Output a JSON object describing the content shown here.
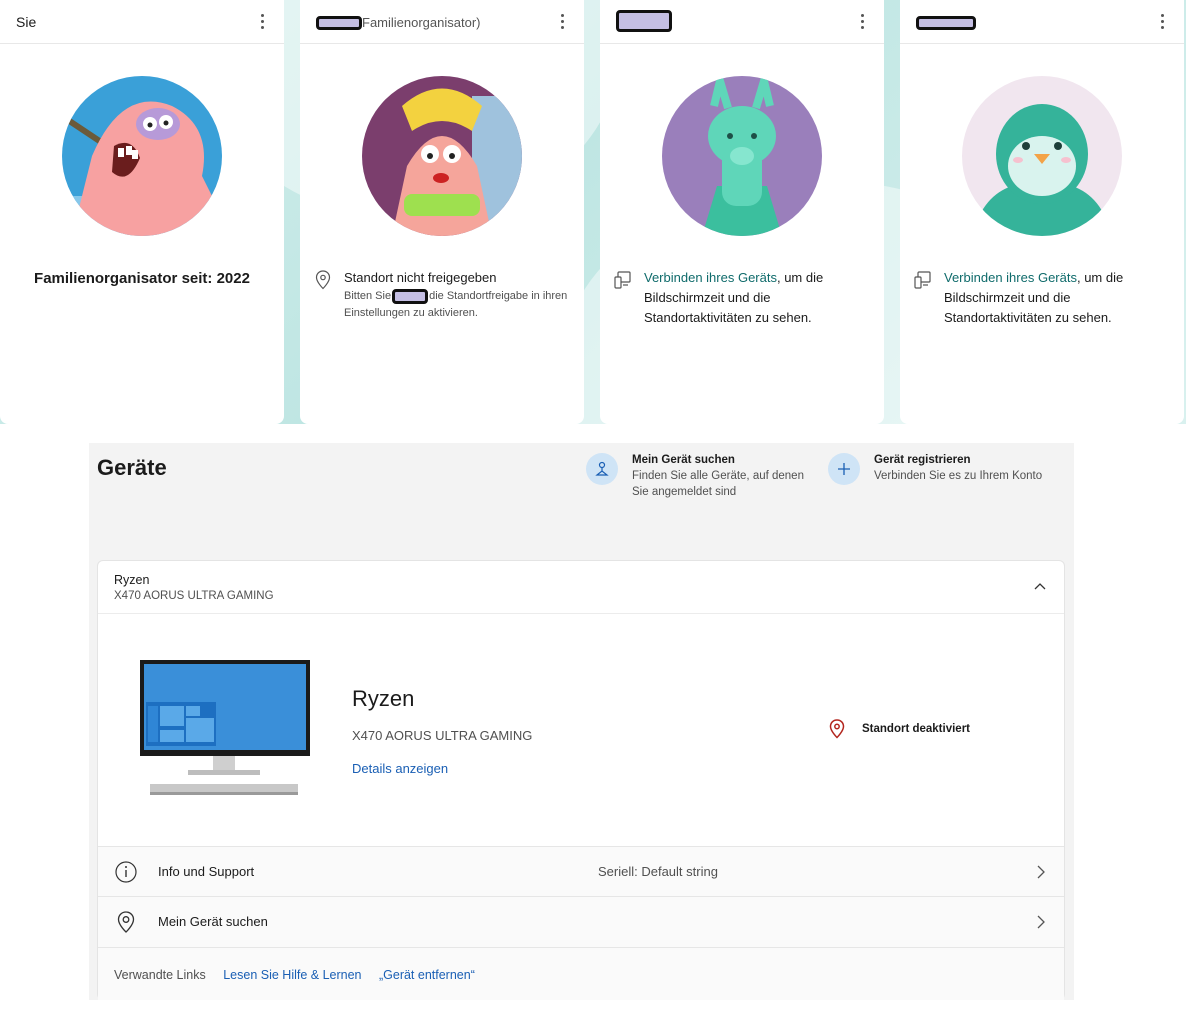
{
  "family": {
    "members": [
      {
        "header": "Sie",
        "avatar": "patrick-star-avatar",
        "organizer_since": "Familienorganisator seit: 2022"
      },
      {
        "header_suffix": "Familienorganisator)",
        "avatar": "patrick-star-blonde-avatar",
        "location_title": "Standort nicht freigegeben",
        "location_sub_prefix": "Bitten Sie",
        "location_sub_suffix": "die Standortfreigabe in ihren Einstellungen zu aktivieren."
      },
      {
        "avatar": "llama-avatar",
        "connect_link": "Verbinden ihres Geräts",
        "connect_text": ", um die Bildschirmzeit und die Standortaktivitäten zu sehen."
      },
      {
        "avatar": "penguin-avatar",
        "connect_link": "Verbinden ihres Geräts",
        "connect_text": ", um die Bildschirmzeit und die Standortaktivitäten zu sehen."
      }
    ]
  },
  "devices": {
    "title": "Geräte",
    "find_device": {
      "title": "Mein Gerät suchen",
      "desc_line1": "Finden Sie alle Geräte, auf denen",
      "desc_line2": "Sie angemeldet sind"
    },
    "register_device": {
      "title": "Gerät registrieren",
      "desc": "Verbinden Sie es zu Ihrem Konto"
    },
    "device": {
      "name": "Ryzen",
      "model": "X470 AORUS ULTRA GAMING",
      "details_link": "Details anzeigen",
      "location_status": "Standort deaktiviert",
      "rows": [
        {
          "label": "Info und Support",
          "value": "Seriell: Default string"
        },
        {
          "label": "Mein Gerät suchen",
          "value": ""
        }
      ],
      "related_links": {
        "label": "Verwandte Links",
        "links": [
          "Lesen Sie Hilfe & Lernen",
          "„Gerät entfernen“"
        ]
      }
    }
  }
}
